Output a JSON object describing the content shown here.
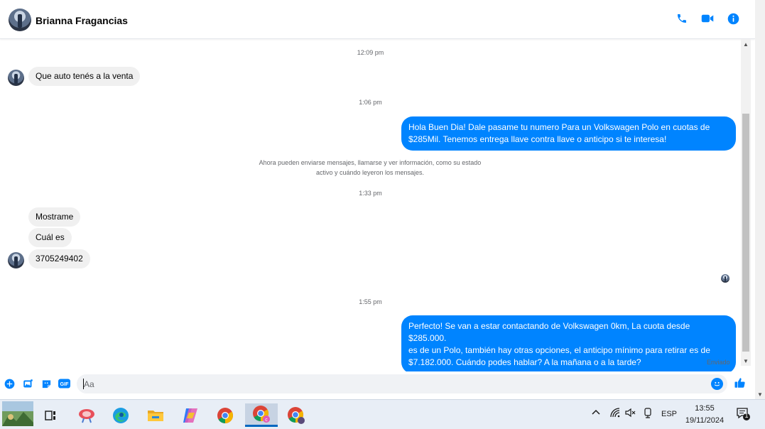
{
  "header": {
    "contact_name": "Brianna Fragancias",
    "icons": [
      "phone-icon",
      "video-call-icon",
      "info-icon"
    ]
  },
  "conversation": {
    "timestamps": [
      "12:09 pm",
      "1:06 pm",
      "1:33 pm",
      "1:55 pm"
    ],
    "info_notice_line1": "Ahora pueden enviarse mensajes, llamarse y ver información, como su estado",
    "info_notice_line2": "activo y cuándo leyeron los mensajes.",
    "messages": [
      {
        "from": "them",
        "text": "Que auto tenés a la venta"
      },
      {
        "from": "me",
        "line1": "Hola Buen Dia! Dale pasame tu numero Para un Volkswagen Polo en cuotas de",
        "line2": "$285Mil. Tenemos entrega llave contra llave o anticipo si te interesa!"
      },
      {
        "from": "them",
        "text": "Mostrame"
      },
      {
        "from": "them",
        "text": "Cuál es"
      },
      {
        "from": "them",
        "text": "3705249402"
      },
      {
        "from": "me",
        "line1": "Perfecto!  Se van a estar contactando de Volkswagen 0km, La cuota desde $285.000.",
        "line2": "es de un Polo, también hay otras opciones, el anticipo mínimo para retirar es de",
        "line3": "$7.182.000. Cuándo podes hablar? A la mañana o a la tarde?"
      }
    ],
    "status": "Enviado"
  },
  "composer": {
    "placeholder": "Aa",
    "icons": [
      "plus-icon",
      "photo-icon",
      "sticker-icon",
      "gif-icon",
      "emoji-icon",
      "like-icon"
    ],
    "gif_label": "GIF"
  },
  "taskbar": {
    "language": "ESP",
    "time": "13:55",
    "date": "19/11/2024",
    "notification_count": "1"
  },
  "colors": {
    "accent": "#0084ff",
    "incoming_bubble": "#f0f0f0"
  }
}
